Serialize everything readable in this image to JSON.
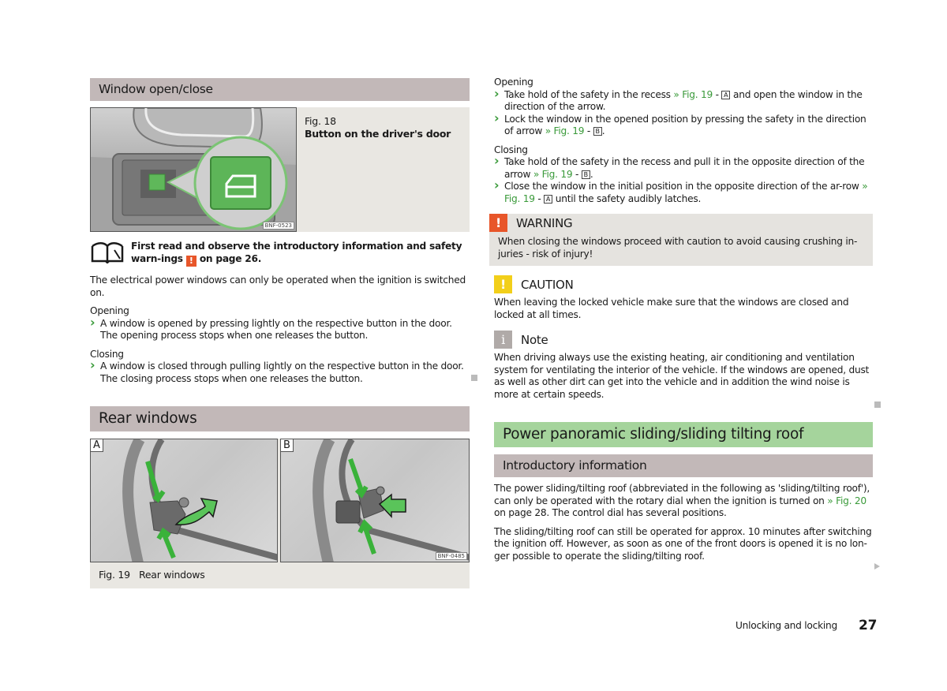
{
  "left": {
    "section1_title": "Window open/close",
    "fig18": {
      "number": "Fig. 18",
      "caption": "Button on the driver's door",
      "code": "BNF-0523"
    },
    "readfirst": {
      "text_before": "First read and observe the introductory information and safety warn-ings",
      "text_after": "on page 26."
    },
    "intro": "The electrical power windows can only be operated when the ignition is switched on.",
    "opening": {
      "heading": "Opening",
      "bullets": [
        "A window is opened by pressing lightly on the respective button in the door. The opening process stops when one releases the button."
      ]
    },
    "closing": {
      "heading": "Closing",
      "bullets": [
        "A window is closed through pulling lightly on the respective button in the door. The closing process stops when one releases the button."
      ]
    },
    "section2_title": "Rear windows",
    "fig19": {
      "panel_a": "A",
      "panel_b": "B",
      "code": "BNF-0485",
      "number": "Fig. 19",
      "caption": "Rear windows"
    }
  },
  "right": {
    "opening": {
      "heading": "Opening",
      "b1": {
        "pre": "Take hold of the safety in the recess",
        "link": "» Fig. 19",
        "mid": "-",
        "key": "A",
        "post": "and open the window in the direction of the arrow."
      },
      "b2": {
        "pre": "Lock the window in the opened position by pressing the safety in the direction of arrow",
        "link": "» Fig. 19",
        "mid": "-",
        "key": "B",
        "post": "."
      }
    },
    "closing": {
      "heading": "Closing",
      "b1": {
        "pre": "Take hold of the safety in the recess and pull it in the opposite direction of the arrow",
        "link": "» Fig. 19",
        "mid": "-",
        "key": "B",
        "post": "."
      },
      "b2": {
        "pre": "Close the window in the initial position in the opposite direction of the ar-row",
        "link": "» Fig. 19",
        "mid": "-",
        "key": "A",
        "post": "until the safety audibly latches."
      }
    },
    "warning": {
      "title": "WARNING",
      "text": "When closing the windows proceed with caution to avoid causing crushing in-juries - risk of injury!",
      "color": "#e8562a"
    },
    "caution": {
      "title": "CAUTION",
      "text": "When leaving the locked vehicle make sure that the windows are closed and locked at all times.",
      "color": "#f2cf1a"
    },
    "note": {
      "title": "Note",
      "text": "When driving always use the existing heating, air conditioning and ventilation system for ventilating the interior of the vehicle. If the windows are opened, dust as well as other dirt can get into the vehicle and in addition the wind noise is more at certain speeds.",
      "color": "#b0aaa8"
    },
    "section3_title": "Power panoramic sliding/sliding tilting roof",
    "section3_sub": "Introductory information",
    "para1": {
      "pre": "The power sliding/tilting roof (abbreviated in the following as 'sliding/tilting roof'), can only be operated with the rotary dial when the ignition is turned on",
      "link": "» Fig. 20",
      "post": "on page 28. The control dial has several positions."
    },
    "para2": "The sliding/tilting roof can still be operated for approx. 10 minutes after switching the ignition off. However, as soon as one of the front doors is opened it is no lon-ger possible to operate the sliding/tilting roof."
  },
  "footer": {
    "chapter": "Unlocking and locking",
    "page": "27"
  },
  "colors": {
    "heading_grey": "#c2b8b8",
    "heading_green": "#a5d49c",
    "link_green": "#3a9a3a"
  }
}
